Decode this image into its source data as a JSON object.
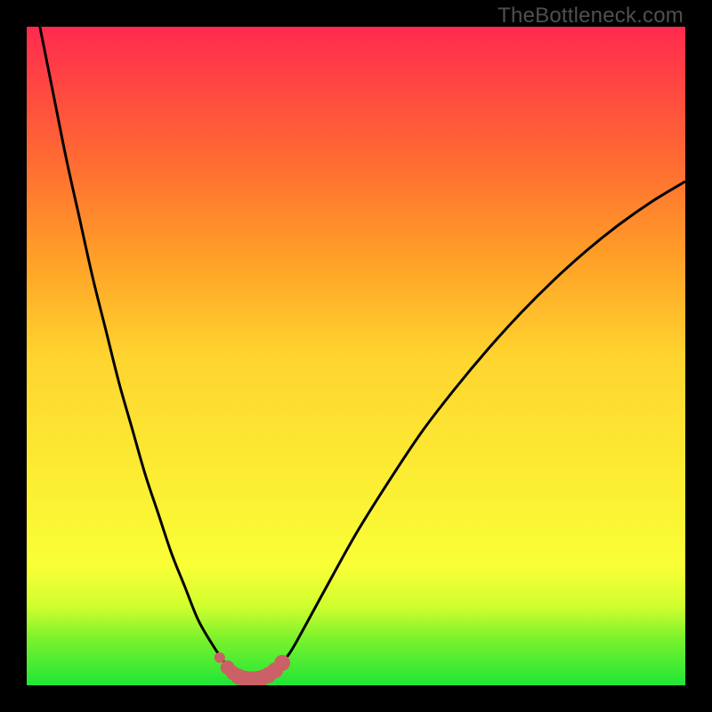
{
  "watermark": "TheBottleneck.com",
  "colors": {
    "frame": "#000000",
    "curve_stroke": "#000000",
    "marker_fill": "#cb6166",
    "green": "#29e83c",
    "yellow": "#feff3b",
    "red": "#ff2f4c",
    "orange": "#ffac27"
  },
  "chart_data": {
    "type": "line",
    "title": "",
    "xlabel": "",
    "ylabel": "",
    "xlim": [
      0,
      100
    ],
    "ylim": [
      0,
      100
    ],
    "gradient_bands": [
      {
        "y": 0,
        "color": "#1fe637"
      },
      {
        "y": 7,
        "color": "#79f22d"
      },
      {
        "y": 12,
        "color": "#d0fe2e"
      },
      {
        "y": 18,
        "color": "#f9ff36"
      },
      {
        "y": 50,
        "color": "#ffd42f"
      },
      {
        "y": 65,
        "color": "#ff9f27"
      },
      {
        "y": 80,
        "color": "#ff6a33"
      },
      {
        "y": 100,
        "color": "#ff2a4e"
      }
    ],
    "series": [
      {
        "name": "bottleneck-curve",
        "x": [
          0,
          2,
          4,
          6,
          8,
          10,
          12,
          14,
          16,
          18,
          20,
          22,
          24,
          26,
          28,
          30,
          31,
          32,
          33,
          34,
          35,
          36,
          37,
          38,
          40,
          42,
          45,
          50,
          55,
          60,
          65,
          70,
          75,
          80,
          85,
          90,
          95,
          100
        ],
        "y": [
          110,
          100,
          90,
          80,
          71,
          62,
          54,
          46,
          39,
          32,
          26,
          20,
          15,
          10,
          6.5,
          3.5,
          2.4,
          1.6,
          1.1,
          0.9,
          0.9,
          1.1,
          1.6,
          2.5,
          5,
          8.5,
          14,
          23,
          31,
          38.5,
          45,
          51,
          56.5,
          61.5,
          66,
          70,
          73.5,
          76.5
        ]
      }
    ],
    "markers": {
      "name": "highlighted-range",
      "x": [
        29.3,
        30.5,
        31.3,
        32.2,
        33.1,
        34.0,
        34.9,
        35.8,
        36.7,
        37.7,
        38.8
      ],
      "y": [
        4.2,
        2.7,
        1.9,
        1.3,
        1.0,
        0.9,
        0.95,
        1.15,
        1.55,
        2.25,
        3.4
      ],
      "r": [
        6,
        8,
        8,
        9,
        9,
        9,
        9,
        9,
        9,
        9,
        9
      ]
    }
  }
}
